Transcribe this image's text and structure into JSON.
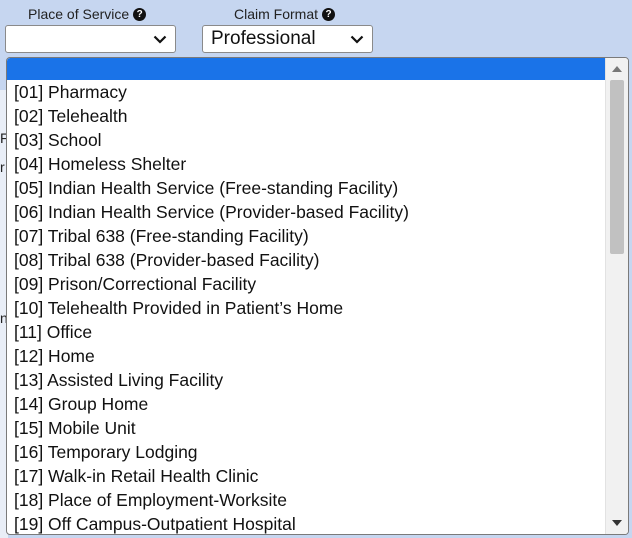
{
  "place_of_service": {
    "label": "Place of Service",
    "help_icon": "question-circle-icon",
    "selected_value": ""
  },
  "claim_format": {
    "label": "Claim Format",
    "help_icon": "question-circle-icon",
    "selected_value": "Professional"
  },
  "background_fragments": [
    "F",
    "r",
    "nt"
  ],
  "dropdown": {
    "options": [
      "",
      "[01] Pharmacy",
      "[02] Telehealth",
      "[03] School",
      "[04] Homeless Shelter",
      "[05] Indian Health Service (Free-standing Facility)",
      "[06] Indian Health Service (Provider-based Facility)",
      "[07] Tribal 638 (Free-standing Facility)",
      "[08] Tribal 638 (Provider-based Facility)",
      "[09] Prison/Correctional Facility",
      "[10] Telehealth Provided in Patient’s Home",
      "[11] Office",
      "[12] Home",
      "[13] Assisted Living Facility",
      "[14] Group Home",
      "[15] Mobile Unit",
      "[16] Temporary Lodging",
      "[17] Walk-in Retail Health Clinic",
      "[18] Place of Employment-Worksite",
      "[19] Off Campus-Outpatient Hospital"
    ],
    "highlighted_index": 0,
    "highlight_color": "#1a73e8"
  }
}
